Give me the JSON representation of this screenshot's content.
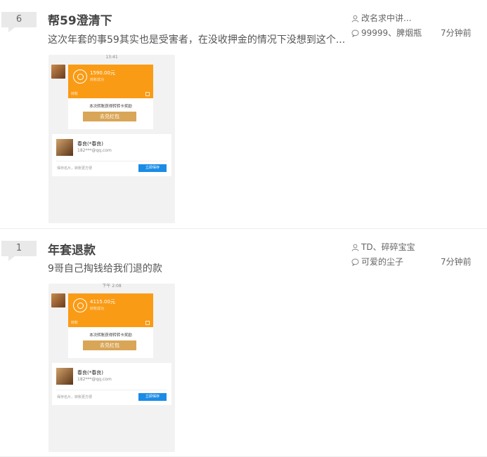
{
  "threads": [
    {
      "reply_count": "6",
      "title": "帮59澄清下",
      "excerpt": "这次年套的事59其实也是受害者，在没收押金的情况下没想到这个...",
      "author": "改名求中讲...",
      "last_reply": "99999、脾烟瓶",
      "time": "7分钟前",
      "thumb": {
        "clock": "13:41",
        "amount": "1590.00元",
        "status": "转账成功",
        "kind": "转账",
        "promo": "本次转账获得转转卡奖励",
        "redeem": "去兑红包",
        "contact_name": "春良(*春良)",
        "contact_mail": "182***@qq.com",
        "hint": "保存名片，转账更方便",
        "save": "立即保存"
      }
    },
    {
      "reply_count": "1",
      "title": "年套退款",
      "excerpt": "9哥自己掏钱给我们退的款",
      "author": "TD、碎碎宝宝",
      "last_reply": "可爱的尘子",
      "time": "7分钟前",
      "thumb": {
        "clock": "下午 2:08",
        "amount": "4115.00元",
        "status": "转账成功",
        "kind": "转账",
        "promo": "本次转账获得转转卡奖励",
        "redeem": "去兑红包",
        "contact_name": "春良(*春良)",
        "contact_mail": "182***@qq.com",
        "hint": "保存名片，转账更方便",
        "save": "立即保存"
      }
    }
  ],
  "colors": {
    "accent_orange": "#fa9b15",
    "redeem_gold": "#d9a657",
    "save_blue": "#1a8ce6",
    "badge_bg": "#e9e9e9"
  },
  "icons": {
    "author": "user-icon",
    "reply": "comment-icon"
  }
}
